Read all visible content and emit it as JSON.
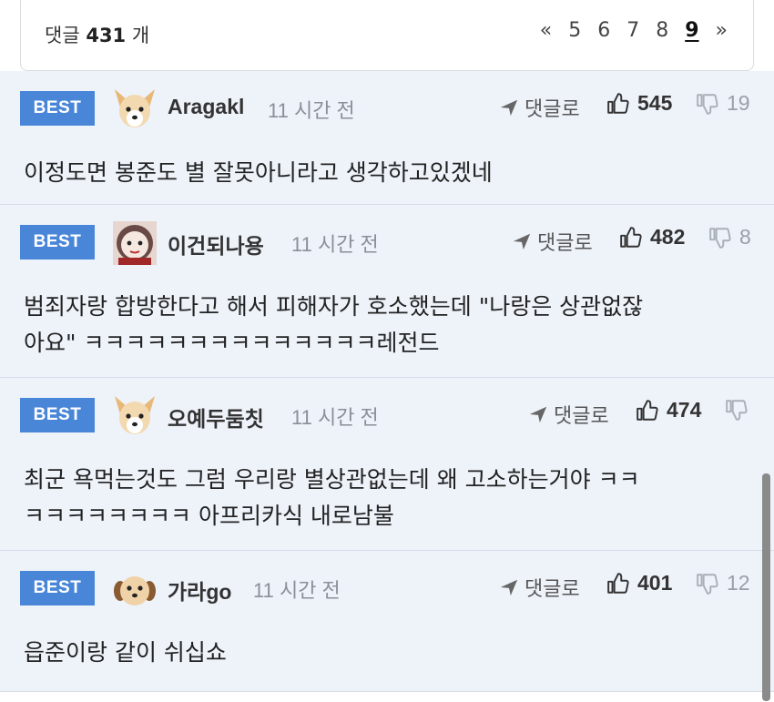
{
  "header": {
    "count_prefix": "댓글",
    "count": "431",
    "count_suffix": "개",
    "pages": [
      "«",
      "5",
      "6",
      "7",
      "8",
      "9",
      "»"
    ],
    "current_page": "9"
  },
  "reply_label": "댓글로",
  "best_label": "BEST",
  "comments": [
    {
      "nick": "Aragakl",
      "time": "11 시간 전",
      "likes": "545",
      "dislikes": "19",
      "text": "이정도면 봉준도 별 잘못아니라고 생각하고있겠네",
      "avatar": "dog-avatar-icon"
    },
    {
      "nick": "이건되나용",
      "time": "11 시간 전",
      "likes": "482",
      "dislikes": "8",
      "text": "범죄자랑 합방한다고 해서 피해자가 호소했는데 \"나랑은 상관없잖\n아요\" ㅋㅋㅋㅋㅋㅋㅋㅋㅋㅋㅋㅋㅋㅋ레전드",
      "avatar": "pixel-face-avatar-icon"
    },
    {
      "nick": "오예두둠칫",
      "time": "11 시간 전",
      "likes": "474",
      "dislikes": "",
      "text": "최군 욕먹는것도 그럼 우리랑 별상관없는데 왜 고소하는거야 ㅋㅋ\nㅋㅋㅋㅋㅋㅋㅋㅋ 아프리카식 내로남불",
      "avatar": "dog-avatar-icon"
    },
    {
      "nick": "가라go",
      "time": "11 시간 전",
      "likes": "401",
      "dislikes": "12",
      "text": "읍준이랑 같이 쉬십쇼",
      "avatar": "puppy-avatar-icon"
    }
  ]
}
